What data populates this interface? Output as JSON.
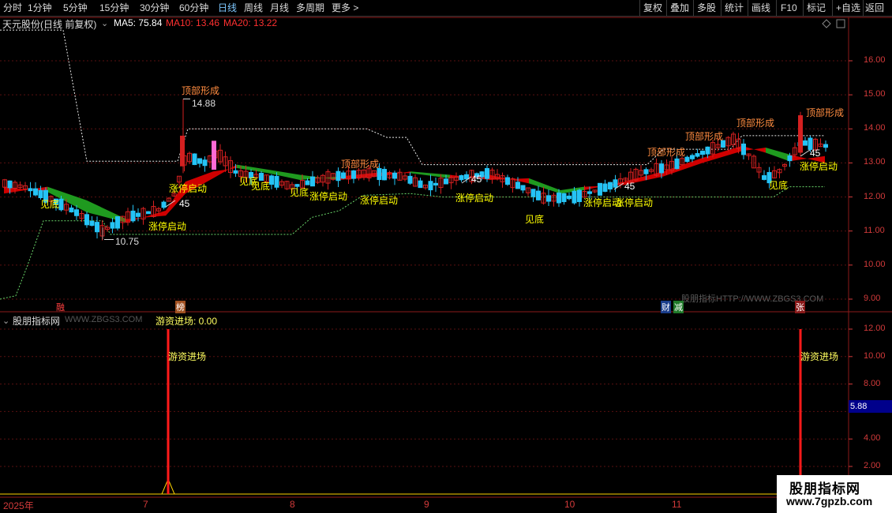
{
  "toolbar": {
    "periods": [
      "分时",
      "1分钟",
      "5分钟",
      "15分钟",
      "30分钟",
      "60分钟",
      "日线",
      "周线",
      "月线",
      "多周期",
      "更多 >"
    ],
    "active_period": "日线",
    "actions": [
      "复权",
      "叠加",
      "多股",
      "统计",
      "画线",
      "F10",
      "标记",
      "+自选",
      "返回"
    ]
  },
  "main": {
    "stock_title": "天元股份(日线 前复权)",
    "ma5": "MA5: 75.84",
    "ma10": "MA10: 13.46",
    "ma20": "MA20: 13.22",
    "watermark": "股朋指标HTTP://WWW.ZBGS3.COM",
    "annotations": {
      "peak1": "顶部形成",
      "peak2": "顶部形成",
      "peak3": "顶部形成",
      "peak4": "顶部形成",
      "peak5": "顶部形成",
      "high_label": "14.88",
      "low_label": "10.75",
      "bottom1": "见底",
      "bottom2": "见底",
      "bottom3": "见底",
      "bottom4": "见底",
      "bottom5": "见底",
      "bottom6": "见底",
      "start1": "涨停启动",
      "start2": "涨停启动",
      "start3": "涨停启动",
      "start4": "涨停启动",
      "start5": "涨停启动",
      "start6": "涨停启动",
      "start7": "涨停启动",
      "start8": "涨停启动",
      "num45_1": "45",
      "num45_2": "45",
      "num45_3": "45",
      "num45_4": "45"
    },
    "markers": {
      "m_rong": "融",
      "m_bang": "榜",
      "m_cai": "财",
      "m_jian": "减",
      "m_zhang": "张"
    }
  },
  "sub": {
    "title": "股朋指标网",
    "url": "WWW.ZBGS3.COM",
    "indicator_label": "游资进场: 0.00",
    "spike_label1": "游资进场",
    "spike_label2": "游资进场",
    "value_badge": "5.88"
  },
  "x_axis": {
    "year": "2025年",
    "months": [
      "7",
      "8",
      "9",
      "10",
      "11"
    ]
  },
  "logo": {
    "name": "股朋指标网",
    "url": "www.7gpzb.com"
  },
  "chart_data": [
    {
      "type": "candlestick",
      "title": "天元股份(日线 前复权)",
      "y_ticks": [
        9.0,
        10.0,
        11.0,
        12.0,
        13.0,
        14.0,
        15.0,
        16.0
      ],
      "ylim": [
        8.8,
        16.5
      ],
      "high": 14.88,
      "low": 10.75,
      "ma": {
        "MA5": 75.84,
        "MA10": 13.46,
        "MA20": 13.22
      }
    },
    {
      "type": "line",
      "title": "游资进场",
      "y_ticks": [
        2.0,
        4.0,
        6.0,
        8.0,
        10.0,
        12.0
      ],
      "current": 0.0,
      "badge": 5.88
    }
  ],
  "colors": {
    "up": "#d42020",
    "down": "#25c3f5",
    "ribbon_up": "#d00000",
    "ribbon_down": "#1f9a1f",
    "label_yellow": "#ffff00",
    "label_orange": "#ff8c40",
    "axis_red": "#d23a3a"
  }
}
